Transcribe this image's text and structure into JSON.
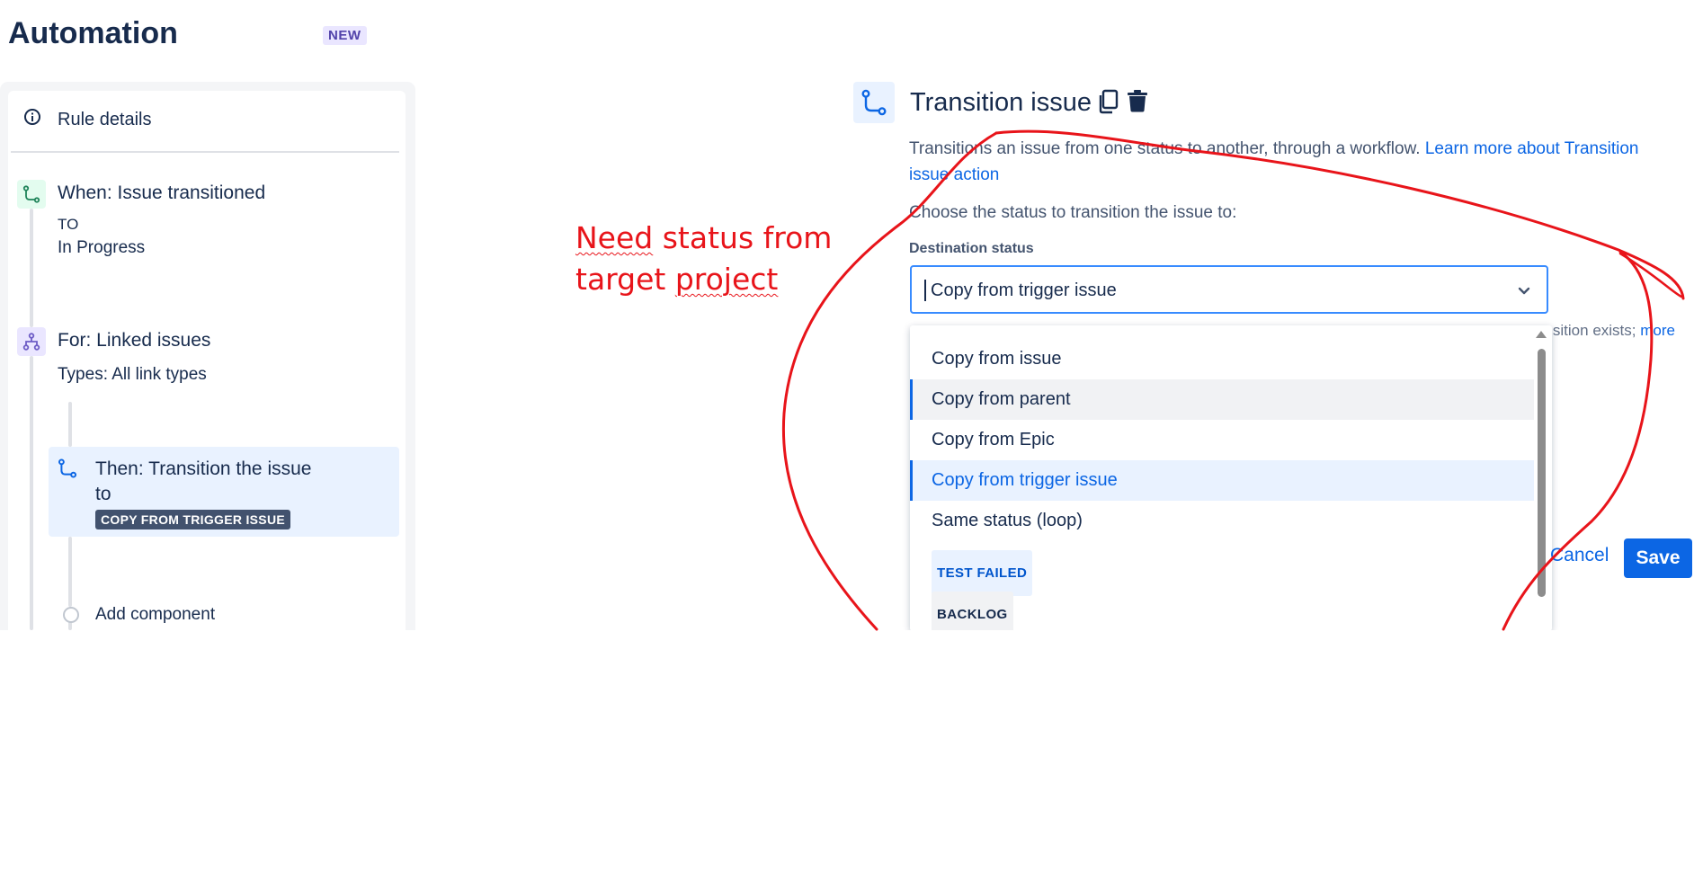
{
  "header": {
    "title": "Automation",
    "badge": "NEW"
  },
  "rule": {
    "details_label": "Rule details",
    "trigger": {
      "title": "When: Issue transitioned",
      "to_label": "TO",
      "to_value": "In Progress"
    },
    "branch": {
      "title": "For: Linked issues",
      "types": "Types: All link types"
    },
    "action": {
      "title_line1": "Then: Transition the issue",
      "title_line2": "to",
      "lozenge": "COPY FROM TRIGGER ISSUE"
    },
    "add_component": "Add component"
  },
  "annotation": {
    "line1_a": "Need",
    "line1_b": " status from",
    "line2_a": "target ",
    "line2_b": "project",
    "color": "#e8141a"
  },
  "config": {
    "title": "Transition issue",
    "description": "Transitions an issue from one status to another, through a workflow. ",
    "learn_more": "Learn more about Transition issue action",
    "choose_label": "Choose the status to transition the issue to:",
    "field_label": "Destination status",
    "selected_value": "Copy from trigger issue",
    "hint_text": "ansition exists; ",
    "hint_link": "more",
    "options": [
      {
        "label": "Copy from issue",
        "state": "normal"
      },
      {
        "label": "Copy from parent",
        "state": "hover"
      },
      {
        "label": "Copy from Epic",
        "state": "normal"
      },
      {
        "label": "Copy from trigger issue",
        "state": "selected"
      },
      {
        "label": "Same status (loop)",
        "state": "normal"
      }
    ],
    "status_options": [
      {
        "label": "TEST FAILED",
        "color": "#0055cc"
      },
      {
        "label": "BACKLOG",
        "color": "#172b4d"
      }
    ],
    "cancel_label": "Cancel",
    "save_label": "Save"
  },
  "icons": [
    "info-icon",
    "transition-icon",
    "branch-icon",
    "copy-icon",
    "trash-icon",
    "chevron-down-icon"
  ],
  "colors": {
    "accent": "#0c66e4",
    "text": "#172b4d"
  }
}
